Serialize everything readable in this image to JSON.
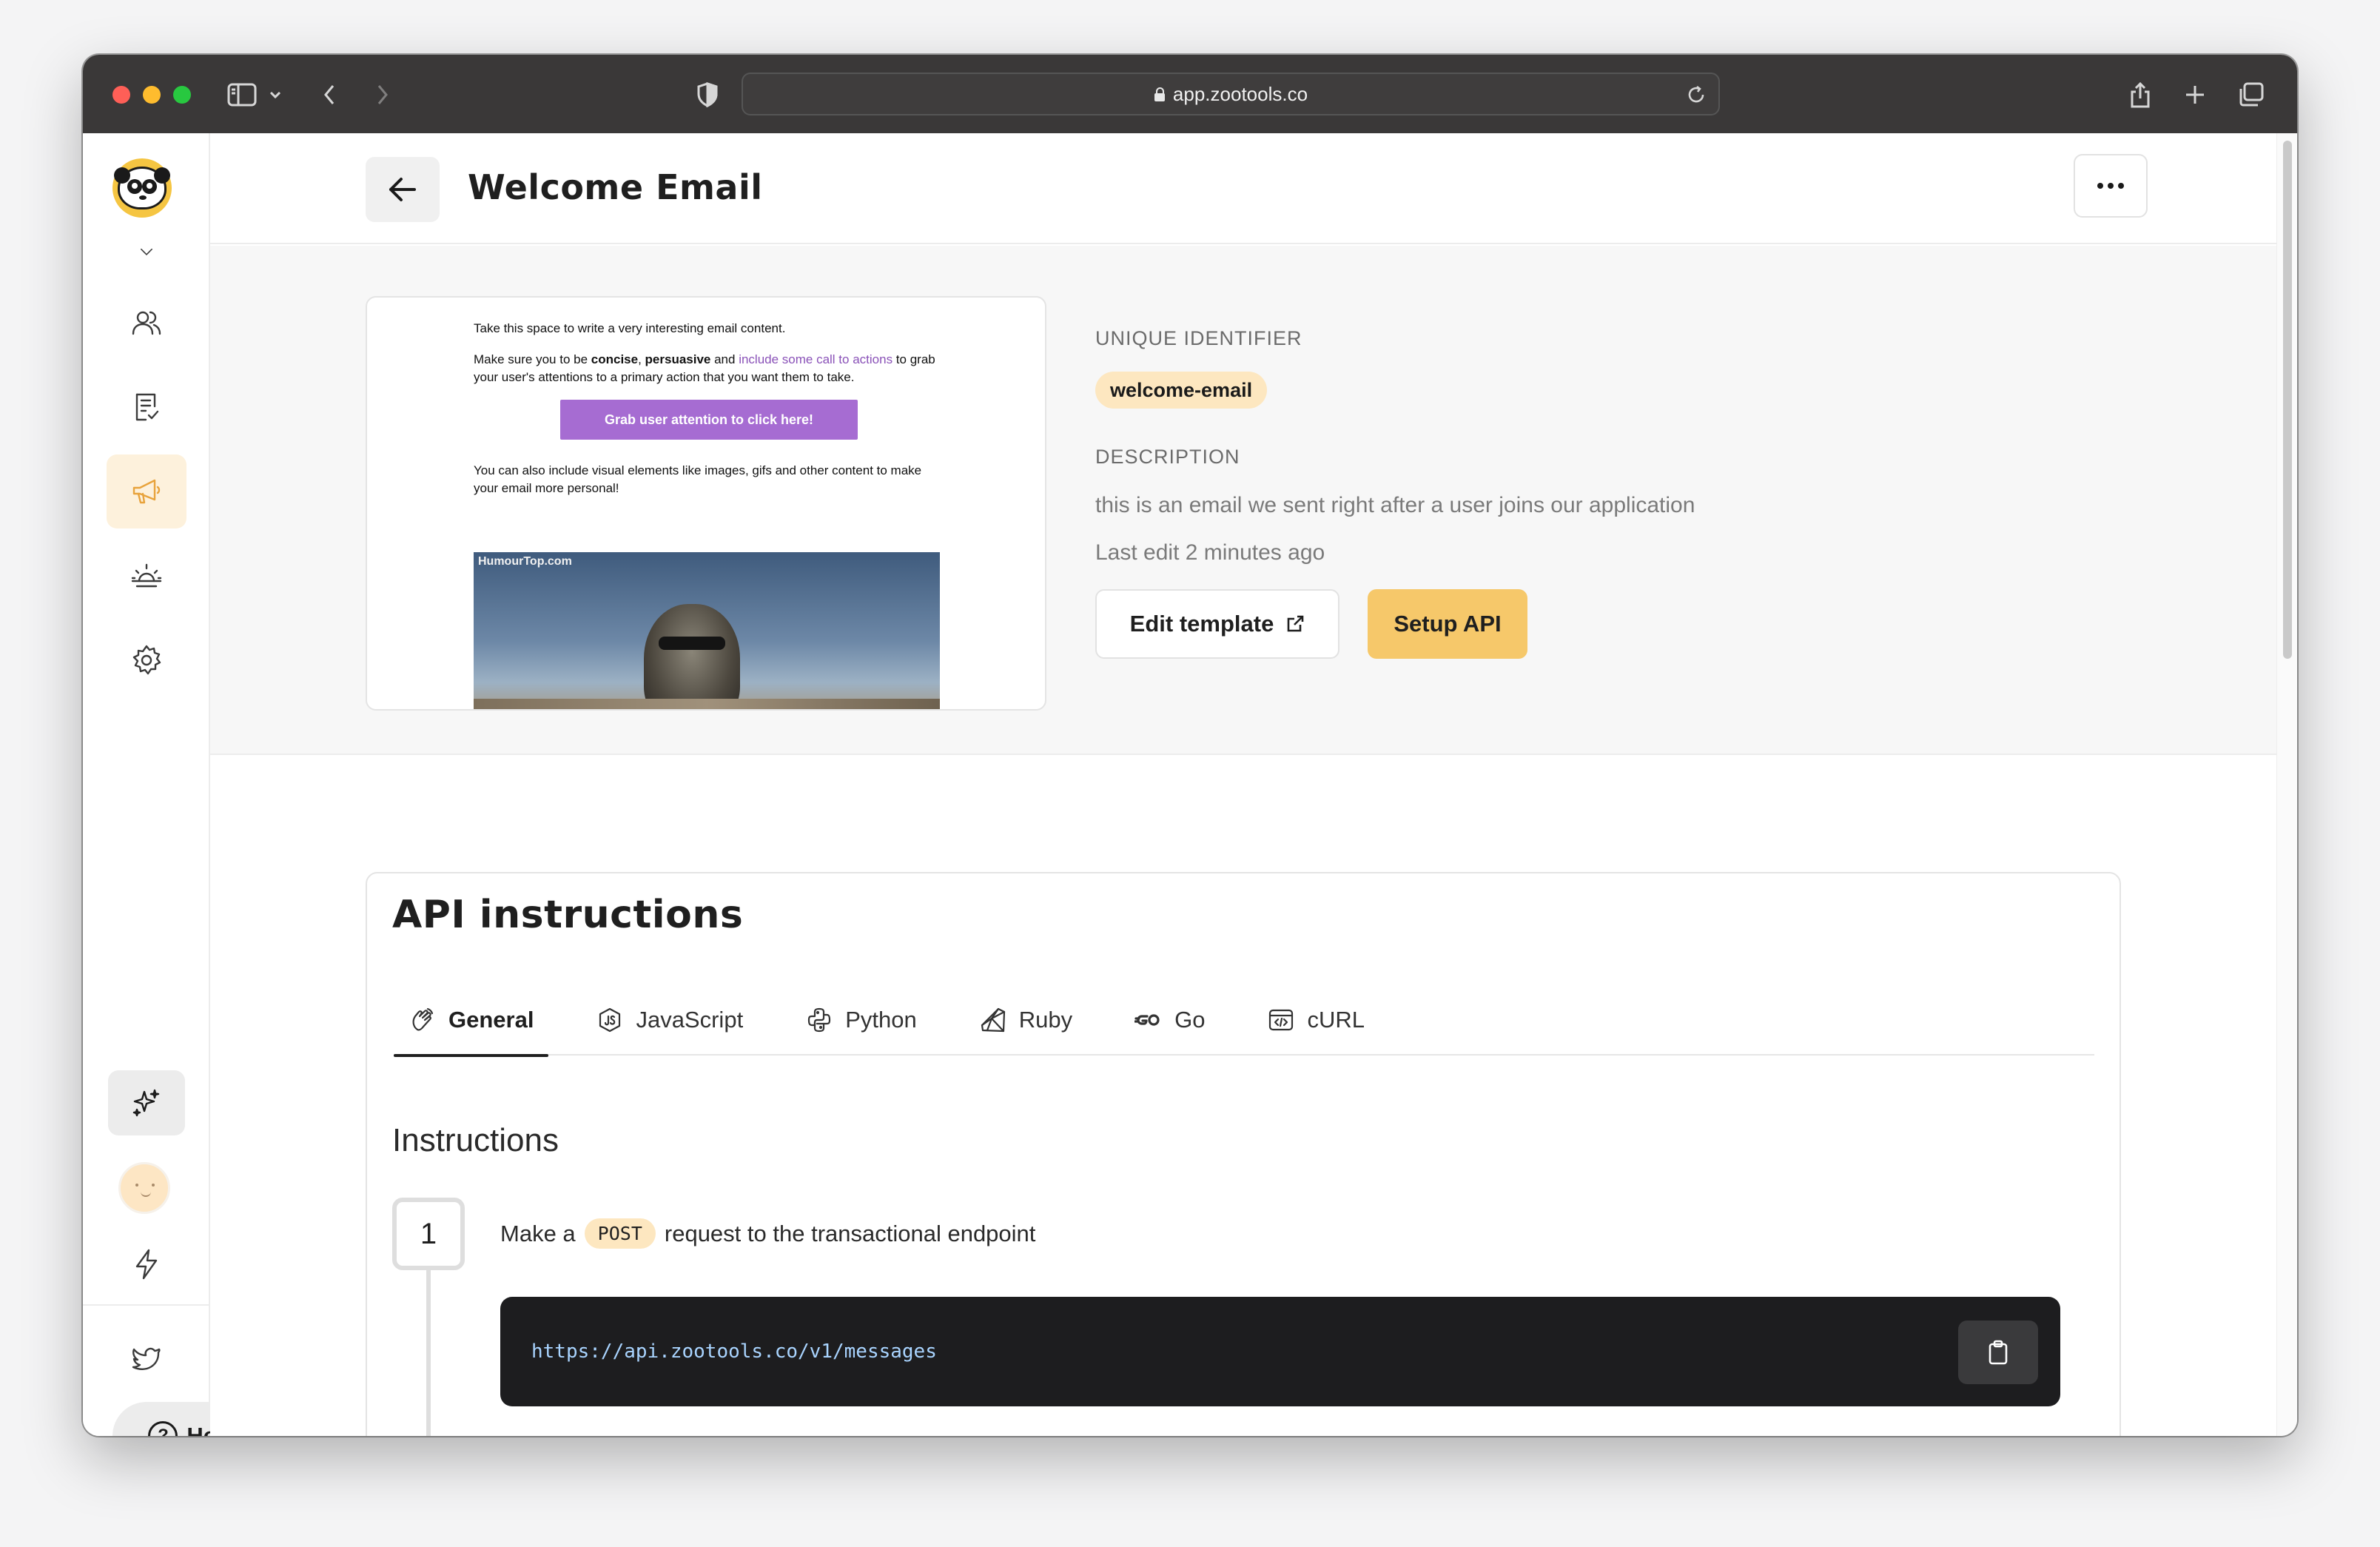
{
  "browser": {
    "url": "app.zootools.co"
  },
  "sidebar": {
    "items": [
      {
        "name": "users",
        "icon": "users-icon"
      },
      {
        "name": "forms",
        "icon": "checklist-icon"
      },
      {
        "name": "campaigns",
        "icon": "megaphone-icon",
        "active": true
      },
      {
        "name": "sunrise",
        "icon": "sunrise-icon"
      },
      {
        "name": "settings",
        "icon": "gear-icon"
      }
    ],
    "help_label": "Help"
  },
  "header": {
    "title": "Welcome Email"
  },
  "preview": {
    "line1": "Take this space to write a very interesting email content.",
    "line2_a": "Make sure you to be ",
    "line2_bold1": "concise",
    "line2_sep": ", ",
    "line2_bold2": "persuasive",
    "line2_and": " and ",
    "line2_link": "include some call to actions",
    "line2_rest": " to grab your user's attentions to a primary action that you want them to take.",
    "cta": "Grab user attention to click here!",
    "line3": "You can also include visual elements like images, gifs and other content to make your email more personal!",
    "image_watermark": "HumourTop.com"
  },
  "details": {
    "identifier_label": "UNIQUE IDENTIFIER",
    "identifier": "welcome-email",
    "description_label": "DESCRIPTION",
    "description": "this is an email we sent right after a user joins our application",
    "last_edit": "Last edit 2 minutes ago",
    "edit_template_label": "Edit template",
    "setup_api_label": "Setup API"
  },
  "api": {
    "title": "API instructions",
    "tabs": [
      {
        "label": "General",
        "icon": "general-icon",
        "active": true
      },
      {
        "label": "JavaScript",
        "icon": "javascript-icon"
      },
      {
        "label": "Python",
        "icon": "python-icon"
      },
      {
        "label": "Ruby",
        "icon": "ruby-icon"
      },
      {
        "label": "Go",
        "icon": "go-icon"
      },
      {
        "label": "cURL",
        "icon": "curl-icon"
      }
    ],
    "instructions_title": "Instructions",
    "step1": {
      "number": "1",
      "text_before": "Make a",
      "method": "POST",
      "text_after": "request to the transactional endpoint",
      "endpoint": "https://api.zootools.co/v1/messages"
    }
  }
}
